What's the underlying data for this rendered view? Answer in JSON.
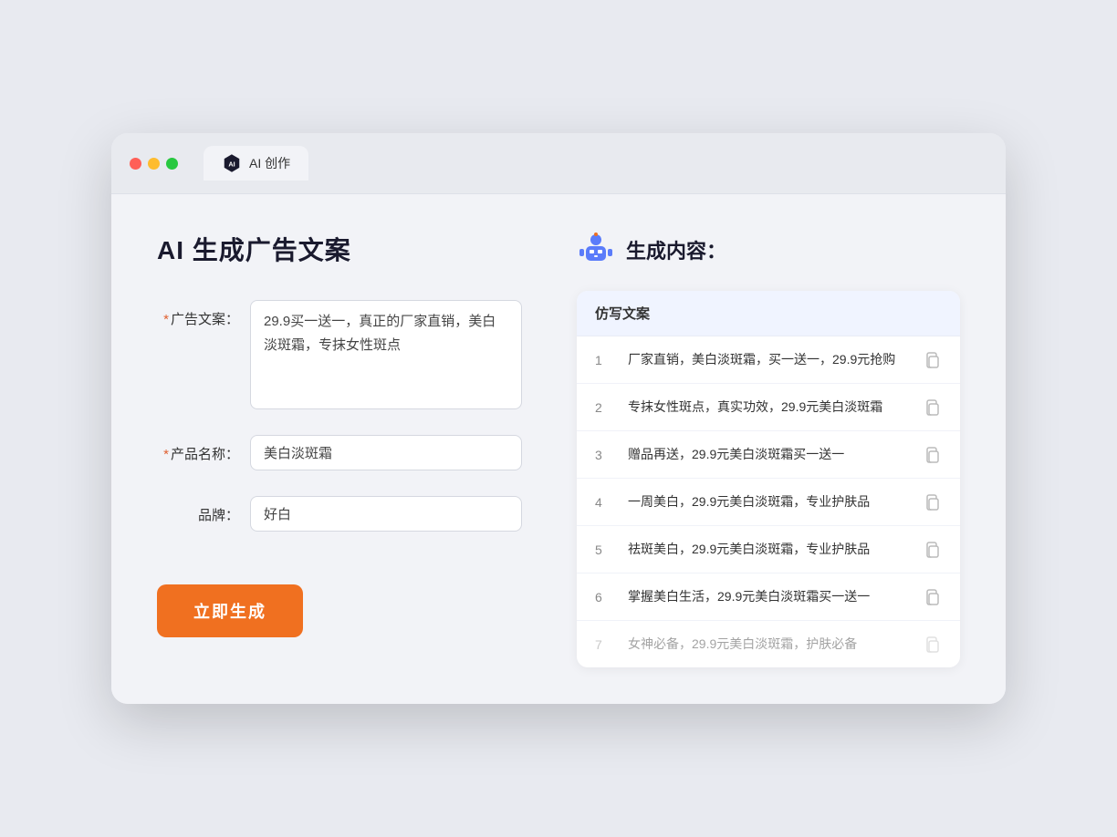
{
  "browser": {
    "tab_label": "AI 创作"
  },
  "page": {
    "title": "AI 生成广告文案",
    "result_header": "生成内容："
  },
  "form": {
    "ad_copy_label": "广告文案：",
    "ad_copy_required": true,
    "ad_copy_value": "29.9买一送一，真正的厂家直销，美白淡斑霜，专抹女性斑点",
    "product_name_label": "产品名称：",
    "product_name_required": true,
    "product_name_value": "美白淡斑霜",
    "brand_label": "品牌：",
    "brand_required": false,
    "brand_value": "好白",
    "generate_button": "立即生成"
  },
  "results": {
    "table_header": "仿写文案",
    "items": [
      {
        "num": "1",
        "text": "厂家直销，美白淡斑霜，买一送一，29.9元抢购",
        "dimmed": false
      },
      {
        "num": "2",
        "text": "专抹女性斑点，真实功效，29.9元美白淡斑霜",
        "dimmed": false
      },
      {
        "num": "3",
        "text": "赠品再送，29.9元美白淡斑霜买一送一",
        "dimmed": false
      },
      {
        "num": "4",
        "text": "一周美白，29.9元美白淡斑霜，专业护肤品",
        "dimmed": false
      },
      {
        "num": "5",
        "text": "祛斑美白，29.9元美白淡斑霜，专业护肤品",
        "dimmed": false
      },
      {
        "num": "6",
        "text": "掌握美白生活，29.9元美白淡斑霜买一送一",
        "dimmed": false
      },
      {
        "num": "7",
        "text": "女神必备，29.9元美白淡斑霜，护肤必备",
        "dimmed": true
      }
    ]
  }
}
